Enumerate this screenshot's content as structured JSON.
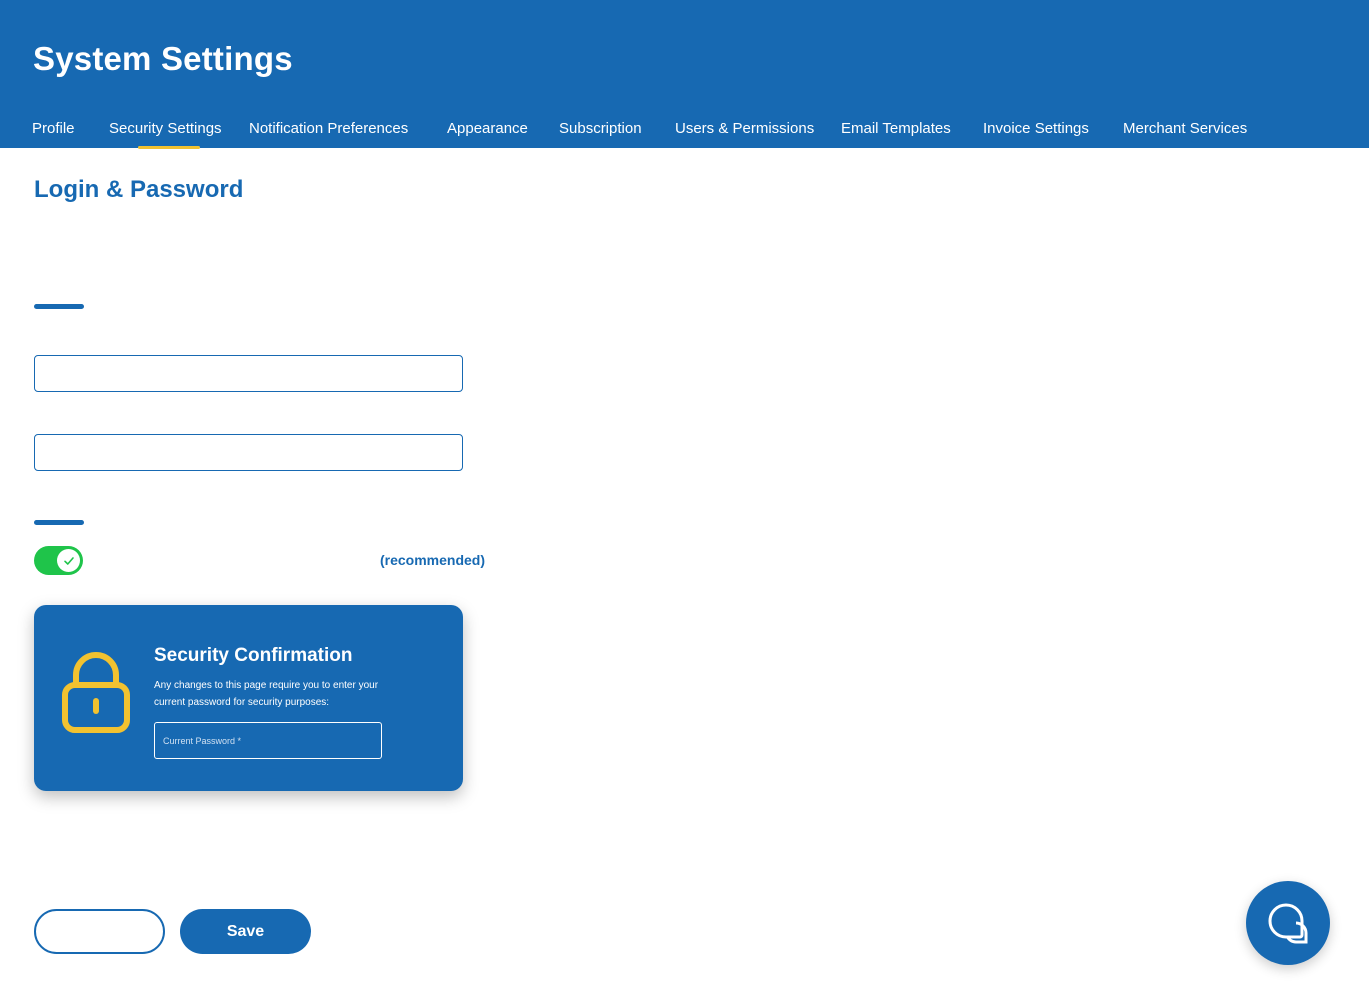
{
  "header": {
    "title": "System Settings",
    "tabs": [
      {
        "label": "Profile"
      },
      {
        "label": "Security Settings"
      },
      {
        "label": "Notification Preferences"
      },
      {
        "label": "Appearance"
      },
      {
        "label": "Subscription"
      },
      {
        "label": "Users & Permissions"
      },
      {
        "label": "Email Templates"
      },
      {
        "label": "Invoice Settings"
      },
      {
        "label": "Merchant Services"
      }
    ],
    "active_tab": "Security Settings"
  },
  "main": {
    "section_title": "Login & Password",
    "inputs": [
      {
        "value": ""
      },
      {
        "value": ""
      }
    ],
    "two_factor": {
      "enabled": true,
      "note": "(recommended)"
    },
    "security_card": {
      "title": "Security Confirmation",
      "description": "Any changes to this page require you to enter your current password for security purposes:",
      "password_placeholder": "Current Password *",
      "icon": "lock-icon"
    }
  },
  "footer": {
    "cancel_label": "",
    "save_label": "Save"
  },
  "chat": {
    "icon": "chat-bubbles-icon"
  },
  "colors": {
    "primary": "#1769b2",
    "accent": "#f2c230",
    "toggle_on": "#1fc44a"
  }
}
